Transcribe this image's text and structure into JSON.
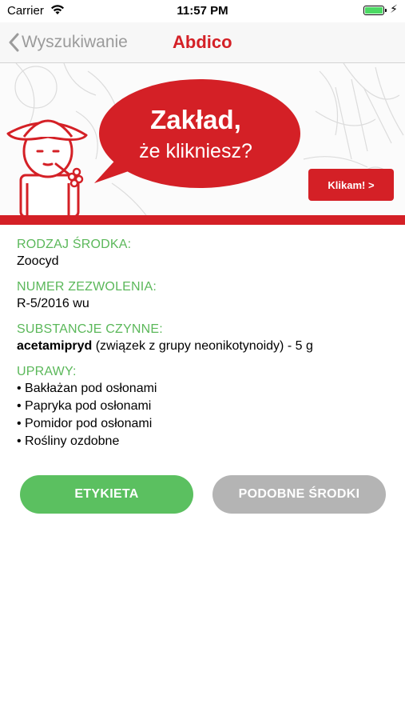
{
  "status_bar": {
    "carrier": "Carrier",
    "time": "11:57 PM",
    "battery_level": 1.0
  },
  "nav": {
    "back_label": "Wyszukiwanie",
    "title": "Abdico"
  },
  "banner": {
    "headline": "Zakład,",
    "subline": "że klikniesz?",
    "button_label": "Klikam!  >"
  },
  "details": {
    "type_label": "RODZAJ ŚRODKA:",
    "type_value": "Zoocyd",
    "permit_label": "NUMER ZEZWOLENIA:",
    "permit_value": "R-5/2016 wu",
    "substances_label": "SUBSTANCJE CZYNNE:",
    "substance_name": "acetamipryd",
    "substance_rest": " (związek z grupy neonikotynoidy) - 5 g",
    "crops_label": "UPRAWY:",
    "crops": [
      "• Bakłażan pod osłonami",
      "• Papryka pod osłonami",
      "• Pomidor pod osłonami",
      "• Rośliny ozdobne"
    ]
  },
  "buttons": {
    "label_button": "ETYKIETA",
    "similar_button": "PODOBNE ŚRODKI"
  },
  "colors": {
    "accent_red": "#d42026",
    "accent_green": "#5bb85a",
    "button_green": "#5bc060",
    "button_gray": "#b4b4b4"
  }
}
